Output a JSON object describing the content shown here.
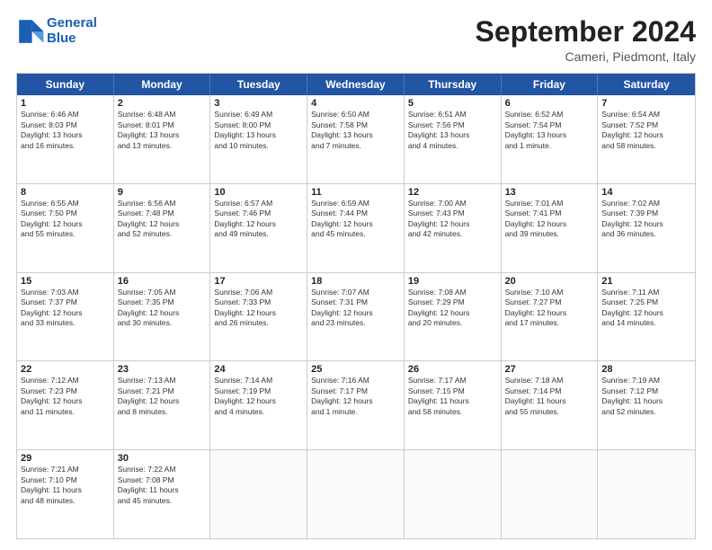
{
  "header": {
    "logo_line1": "General",
    "logo_line2": "Blue",
    "month_title": "September 2024",
    "location": "Cameri, Piedmont, Italy"
  },
  "weekdays": [
    "Sunday",
    "Monday",
    "Tuesday",
    "Wednesday",
    "Thursday",
    "Friday",
    "Saturday"
  ],
  "rows": [
    [
      {
        "day": "1",
        "text": "Sunrise: 6:46 AM\nSunset: 8:03 PM\nDaylight: 13 hours\nand 16 minutes."
      },
      {
        "day": "2",
        "text": "Sunrise: 6:48 AM\nSunset: 8:01 PM\nDaylight: 13 hours\nand 13 minutes."
      },
      {
        "day": "3",
        "text": "Sunrise: 6:49 AM\nSunset: 8:00 PM\nDaylight: 13 hours\nand 10 minutes."
      },
      {
        "day": "4",
        "text": "Sunrise: 6:50 AM\nSunset: 7:58 PM\nDaylight: 13 hours\nand 7 minutes."
      },
      {
        "day": "5",
        "text": "Sunrise: 6:51 AM\nSunset: 7:56 PM\nDaylight: 13 hours\nand 4 minutes."
      },
      {
        "day": "6",
        "text": "Sunrise: 6:52 AM\nSunset: 7:54 PM\nDaylight: 13 hours\nand 1 minute."
      },
      {
        "day": "7",
        "text": "Sunrise: 6:54 AM\nSunset: 7:52 PM\nDaylight: 12 hours\nand 58 minutes."
      }
    ],
    [
      {
        "day": "8",
        "text": "Sunrise: 6:55 AM\nSunset: 7:50 PM\nDaylight: 12 hours\nand 55 minutes."
      },
      {
        "day": "9",
        "text": "Sunrise: 6:56 AM\nSunset: 7:48 PM\nDaylight: 12 hours\nand 52 minutes."
      },
      {
        "day": "10",
        "text": "Sunrise: 6:57 AM\nSunset: 7:46 PM\nDaylight: 12 hours\nand 49 minutes."
      },
      {
        "day": "11",
        "text": "Sunrise: 6:59 AM\nSunset: 7:44 PM\nDaylight: 12 hours\nand 45 minutes."
      },
      {
        "day": "12",
        "text": "Sunrise: 7:00 AM\nSunset: 7:43 PM\nDaylight: 12 hours\nand 42 minutes."
      },
      {
        "day": "13",
        "text": "Sunrise: 7:01 AM\nSunset: 7:41 PM\nDaylight: 12 hours\nand 39 minutes."
      },
      {
        "day": "14",
        "text": "Sunrise: 7:02 AM\nSunset: 7:39 PM\nDaylight: 12 hours\nand 36 minutes."
      }
    ],
    [
      {
        "day": "15",
        "text": "Sunrise: 7:03 AM\nSunset: 7:37 PM\nDaylight: 12 hours\nand 33 minutes."
      },
      {
        "day": "16",
        "text": "Sunrise: 7:05 AM\nSunset: 7:35 PM\nDaylight: 12 hours\nand 30 minutes."
      },
      {
        "day": "17",
        "text": "Sunrise: 7:06 AM\nSunset: 7:33 PM\nDaylight: 12 hours\nand 26 minutes."
      },
      {
        "day": "18",
        "text": "Sunrise: 7:07 AM\nSunset: 7:31 PM\nDaylight: 12 hours\nand 23 minutes."
      },
      {
        "day": "19",
        "text": "Sunrise: 7:08 AM\nSunset: 7:29 PM\nDaylight: 12 hours\nand 20 minutes."
      },
      {
        "day": "20",
        "text": "Sunrise: 7:10 AM\nSunset: 7:27 PM\nDaylight: 12 hours\nand 17 minutes."
      },
      {
        "day": "21",
        "text": "Sunrise: 7:11 AM\nSunset: 7:25 PM\nDaylight: 12 hours\nand 14 minutes."
      }
    ],
    [
      {
        "day": "22",
        "text": "Sunrise: 7:12 AM\nSunset: 7:23 PM\nDaylight: 12 hours\nand 11 minutes."
      },
      {
        "day": "23",
        "text": "Sunrise: 7:13 AM\nSunset: 7:21 PM\nDaylight: 12 hours\nand 8 minutes."
      },
      {
        "day": "24",
        "text": "Sunrise: 7:14 AM\nSunset: 7:19 PM\nDaylight: 12 hours\nand 4 minutes."
      },
      {
        "day": "25",
        "text": "Sunrise: 7:16 AM\nSunset: 7:17 PM\nDaylight: 12 hours\nand 1 minute."
      },
      {
        "day": "26",
        "text": "Sunrise: 7:17 AM\nSunset: 7:15 PM\nDaylight: 11 hours\nand 58 minutes."
      },
      {
        "day": "27",
        "text": "Sunrise: 7:18 AM\nSunset: 7:14 PM\nDaylight: 11 hours\nand 55 minutes."
      },
      {
        "day": "28",
        "text": "Sunrise: 7:19 AM\nSunset: 7:12 PM\nDaylight: 11 hours\nand 52 minutes."
      }
    ],
    [
      {
        "day": "29",
        "text": "Sunrise: 7:21 AM\nSunset: 7:10 PM\nDaylight: 11 hours\nand 48 minutes."
      },
      {
        "day": "30",
        "text": "Sunrise: 7:22 AM\nSunset: 7:08 PM\nDaylight: 11 hours\nand 45 minutes."
      },
      {
        "day": "",
        "text": ""
      },
      {
        "day": "",
        "text": ""
      },
      {
        "day": "",
        "text": ""
      },
      {
        "day": "",
        "text": ""
      },
      {
        "day": "",
        "text": ""
      }
    ]
  ]
}
